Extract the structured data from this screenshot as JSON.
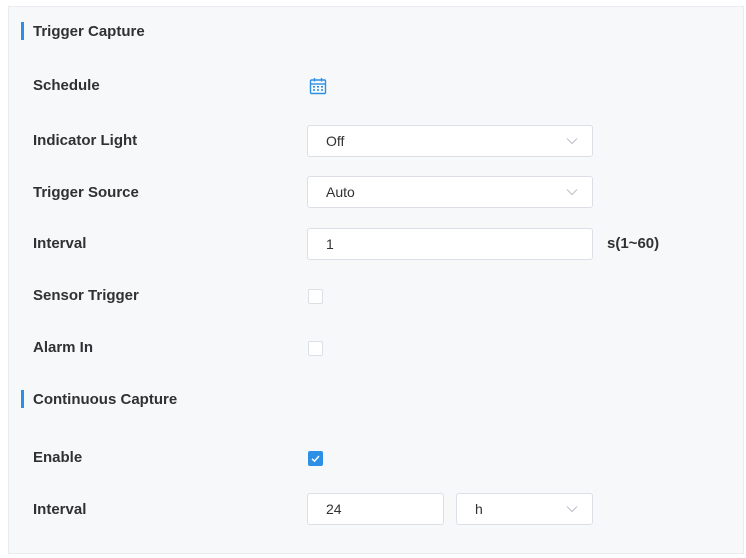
{
  "trigger_capture": {
    "title": "Trigger Capture",
    "schedule": {
      "label": "Schedule",
      "icon": "calendar-icon"
    },
    "indicator_light": {
      "label": "Indicator Light",
      "value": "Off"
    },
    "trigger_source": {
      "label": "Trigger Source",
      "value": "Auto"
    },
    "interval": {
      "label": "Interval",
      "value": "1",
      "unit": "s(1~60)"
    },
    "sensor_trigger": {
      "label": "Sensor Trigger",
      "checked": false
    },
    "alarm_in": {
      "label": "Alarm In",
      "checked": false
    }
  },
  "continuous_capture": {
    "title": "Continuous Capture",
    "enable": {
      "label": "Enable",
      "checked": true
    },
    "interval": {
      "label": "Interval",
      "value": "24",
      "unit_value": "h"
    }
  },
  "colors": {
    "accent": "#2e8fe6",
    "panel_bg": "#f7f8fa",
    "border": "#dcdfe6"
  }
}
